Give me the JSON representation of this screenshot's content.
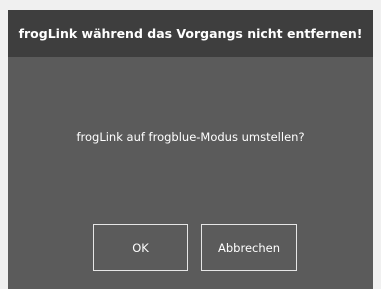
{
  "dialog": {
    "title": "frogLink während das Vorgangs nicht entfernen!",
    "message": "frogLink auf frogblue-Modus umstellen?",
    "buttons": {
      "ok_label": "OK",
      "cancel_label": "Abbrechen"
    }
  },
  "colors": {
    "title_bar": "#3e3e3e",
    "dialog_body": "#5b5b5b",
    "button_border": "#e6e6e6",
    "text": "#ffffff",
    "page_background": "#f0f0f0"
  }
}
